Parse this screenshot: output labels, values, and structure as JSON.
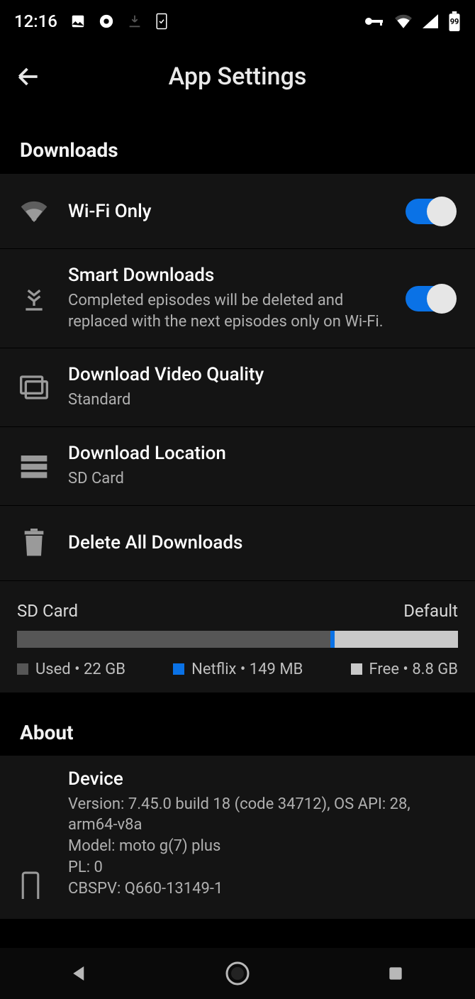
{
  "status": {
    "time": "12:16",
    "battery": "99"
  },
  "header": {
    "title": "App Settings"
  },
  "sections": {
    "downloads_header": "Downloads",
    "about_header": "About"
  },
  "rows": {
    "wifi": {
      "title": "Wi-Fi Only"
    },
    "smart": {
      "title": "Smart Downloads",
      "sub": "Completed episodes will be deleted and replaced with the next episodes only on Wi-Fi."
    },
    "quality": {
      "title": "Download Video Quality",
      "sub": "Standard"
    },
    "location": {
      "title": "Download Location",
      "sub": "SD Card"
    },
    "delete": {
      "title": "Delete All Downloads"
    }
  },
  "storage": {
    "left": "SD Card",
    "right": "Default",
    "legend": {
      "used": "Used • 22 GB",
      "app": "Netflix • 149 MB",
      "free": "Free • 8.8 GB"
    },
    "pct": {
      "used": 71,
      "app": 1,
      "free": 28
    },
    "colors": {
      "used": "#565656",
      "app": "#0a72e6",
      "free": "#c9c9c9"
    }
  },
  "about": {
    "title": "Device",
    "lines": [
      "Version: 7.45.0 build 18 (code 34712), OS API: 28, arm64-v8a",
      "Model: moto g(7) plus",
      "PL: 0",
      "CBSPV: Q660-13149-1"
    ]
  }
}
